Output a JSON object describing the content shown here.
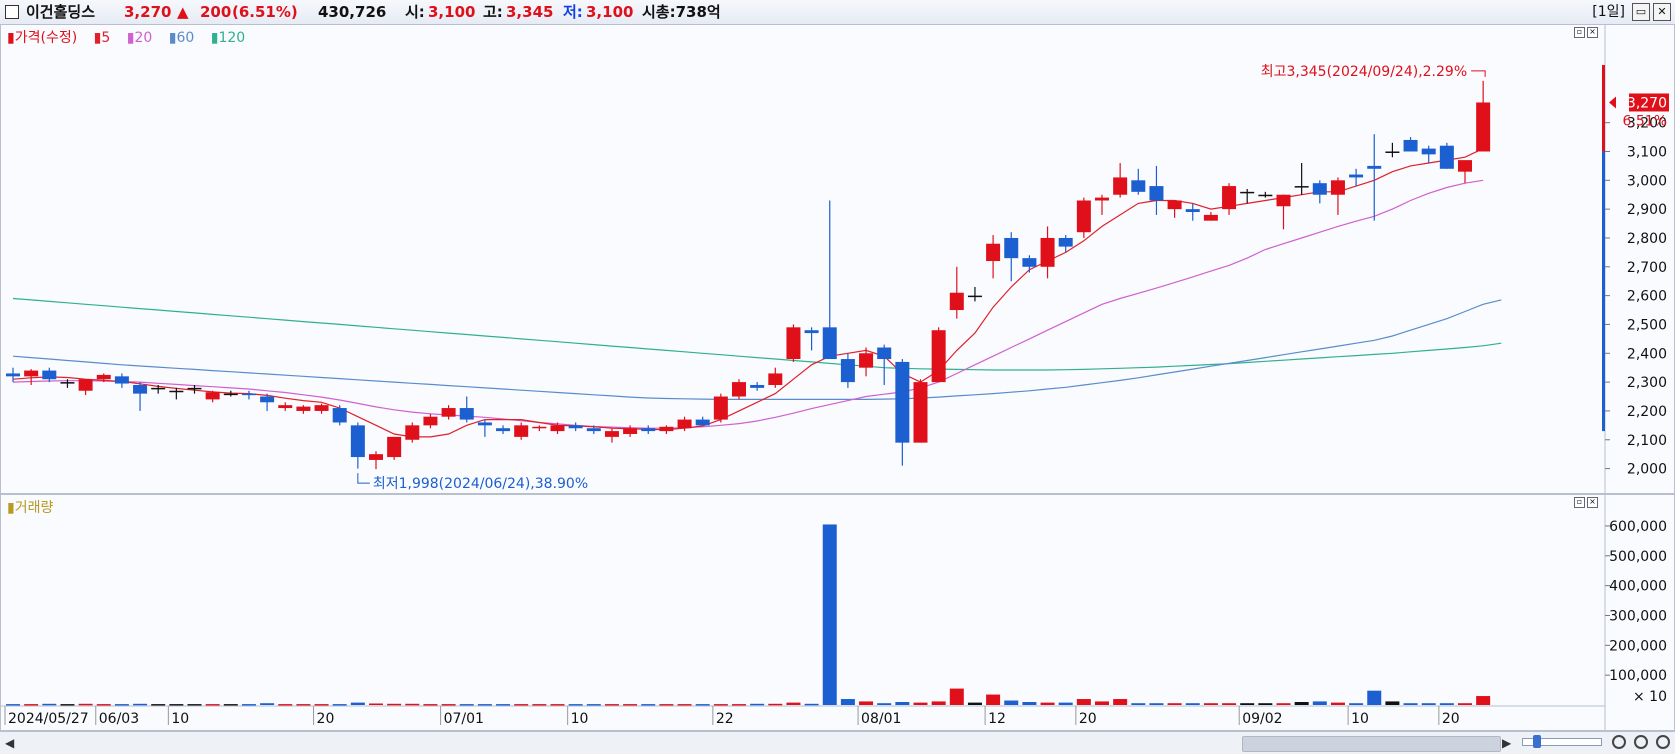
{
  "header": {
    "stock_name": "이건홀딩스",
    "price": "3,270",
    "change_arrow": "▲",
    "change": "200",
    "change_pct": "(6.51%)",
    "volume": "430,726",
    "open_label": "시:",
    "open": "3,100",
    "high_label": "고:",
    "high": "3,345",
    "low_label": "저:",
    "low": "3,100",
    "mktcap": "시총:738억",
    "period": "[1일]"
  },
  "price_panel": {
    "legend_title": "가격(수정)",
    "ma_labels": [
      "5",
      "20",
      "60",
      "120"
    ],
    "max_annotation": "최고3,345(2024/09/24),2.29%",
    "min_annotation": "최저1,998(2024/06/24),38.90%",
    "last_price_tag": "3,270",
    "last_pct_tag": "6.51%"
  },
  "volume_panel": {
    "legend_title": "거래량",
    "unit_label": "× 10"
  },
  "colors": {
    "up": "#e0101a",
    "down": "#1c5fd0",
    "ma5": "#e0202a",
    "ma20": "#d060d0",
    "ma60": "#5a8ccc",
    "ma120": "#30b090"
  },
  "chart_data": [
    {
      "type": "candlestick",
      "title": "가격(수정)",
      "y_axis_ticks": [
        2000,
        2100,
        2200,
        2300,
        2400,
        2500,
        2600,
        2700,
        2800,
        2900,
        3000,
        3100,
        3200
      ],
      "y_axis_labels": [
        "2,000",
        "2,100",
        "2,200",
        "2,300",
        "2,400",
        "2,500",
        "2,600",
        "2,700",
        "2,800",
        "2,900",
        "3,000",
        "3,100",
        "3,200"
      ],
      "ylim": [
        1950,
        3400
      ],
      "x_labels": [
        {
          "i": 0,
          "text": "2024/05/27"
        },
        {
          "i": 5,
          "text": "06/03"
        },
        {
          "i": 9,
          "text": "10"
        },
        {
          "i": 17,
          "text": "20"
        },
        {
          "i": 24,
          "text": "07/01"
        },
        {
          "i": 31,
          "text": "10"
        },
        {
          "i": 39,
          "text": "22"
        },
        {
          "i": 47,
          "text": "08/01"
        },
        {
          "i": 54,
          "text": "12"
        },
        {
          "i": 59,
          "text": "20"
        },
        {
          "i": 68,
          "text": "09/02"
        },
        {
          "i": 74,
          "text": "10"
        },
        {
          "i": 79,
          "text": "20"
        }
      ],
      "candles": [
        [
          2330,
          2350,
          2300,
          2320
        ],
        [
          2320,
          2345,
          2290,
          2340
        ],
        [
          2340,
          2350,
          2300,
          2310
        ],
        [
          2300,
          2310,
          2280,
          2300
        ],
        [
          2270,
          2310,
          2255,
          2310
        ],
        [
          2310,
          2330,
          2300,
          2325
        ],
        [
          2320,
          2330,
          2280,
          2295
        ],
        [
          2290,
          2300,
          2200,
          2260
        ],
        [
          2280,
          2290,
          2260,
          2280
        ],
        [
          2270,
          2280,
          2240,
          2270
        ],
        [
          2280,
          2290,
          2260,
          2280
        ],
        [
          2240,
          2270,
          2230,
          2265
        ],
        [
          2260,
          2270,
          2250,
          2260
        ],
        [
          2260,
          2270,
          2240,
          2255
        ],
        [
          2250,
          2260,
          2200,
          2230
        ],
        [
          2210,
          2230,
          2200,
          2220
        ],
        [
          2200,
          2220,
          2190,
          2215
        ],
        [
          2200,
          2225,
          2190,
          2220
        ],
        [
          2210,
          2220,
          2150,
          2160
        ],
        [
          2150,
          2160,
          2000,
          2040
        ],
        [
          2030,
          2060,
          1998,
          2050
        ],
        [
          2040,
          2110,
          2030,
          2110
        ],
        [
          2100,
          2160,
          2090,
          2150
        ],
        [
          2150,
          2190,
          2140,
          2180
        ],
        [
          2180,
          2220,
          2170,
          2210
        ],
        [
          2210,
          2250,
          2160,
          2170
        ],
        [
          2160,
          2170,
          2110,
          2150
        ],
        [
          2140,
          2150,
          2120,
          2130
        ],
        [
          2110,
          2160,
          2100,
          2150
        ],
        [
          2140,
          2150,
          2130,
          2145
        ],
        [
          2130,
          2160,
          2120,
          2150
        ],
        [
          2150,
          2160,
          2130,
          2140
        ],
        [
          2140,
          2150,
          2120,
          2130
        ],
        [
          2110,
          2140,
          2090,
          2130
        ],
        [
          2120,
          2150,
          2110,
          2140
        ],
        [
          2140,
          2150,
          2120,
          2130
        ],
        [
          2130,
          2150,
          2120,
          2145
        ],
        [
          2140,
          2180,
          2130,
          2170
        ],
        [
          2170,
          2180,
          2150,
          2150
        ],
        [
          2170,
          2260,
          2160,
          2250
        ],
        [
          2250,
          2310,
          2240,
          2300
        ],
        [
          2290,
          2300,
          2270,
          2280
        ],
        [
          2290,
          2350,
          2280,
          2330
        ],
        [
          2380,
          2500,
          2370,
          2490
        ],
        [
          2480,
          2490,
          2410,
          2470
        ],
        [
          2490,
          2930,
          2380,
          2380
        ],
        [
          2380,
          2400,
          2280,
          2300
        ],
        [
          2350,
          2420,
          2320,
          2400
        ],
        [
          2420,
          2430,
          2290,
          2380
        ],
        [
          2370,
          2380,
          2010,
          2090
        ],
        [
          2090,
          2310,
          2090,
          2300
        ],
        [
          2300,
          2490,
          2300,
          2480
        ],
        [
          2550,
          2700,
          2520,
          2610
        ],
        [
          2600,
          2630,
          2580,
          2600
        ],
        [
          2720,
          2810,
          2660,
          2780
        ],
        [
          2800,
          2820,
          2650,
          2730
        ],
        [
          2730,
          2740,
          2680,
          2700
        ],
        [
          2700,
          2840,
          2660,
          2800
        ],
        [
          2800,
          2810,
          2750,
          2770
        ],
        [
          2820,
          2940,
          2800,
          2930
        ],
        [
          2930,
          2950,
          2880,
          2940
        ],
        [
          2950,
          3060,
          2940,
          3010
        ],
        [
          3000,
          3040,
          2950,
          2960
        ],
        [
          2980,
          3050,
          2880,
          2930
        ],
        [
          2900,
          2920,
          2870,
          2930
        ],
        [
          2900,
          2920,
          2860,
          2890
        ],
        [
          2860,
          2890,
          2860,
          2880
        ],
        [
          2900,
          2990,
          2880,
          2980
        ],
        [
          2960,
          2970,
          2920,
          2960
        ],
        [
          2950,
          2960,
          2940,
          2950
        ],
        [
          2910,
          2950,
          2830,
          2950
        ],
        [
          2980,
          3060,
          2950,
          2980
        ],
        [
          2990,
          3000,
          2920,
          2950
        ],
        [
          2950,
          3010,
          2880,
          3000
        ],
        [
          3020,
          3040,
          2980,
          3010
        ],
        [
          3050,
          3160,
          2860,
          3040
        ],
        [
          3100,
          3130,
          3080,
          3100
        ],
        [
          3140,
          3150,
          3100,
          3100
        ],
        [
          3110,
          3120,
          3060,
          3090
        ],
        [
          3120,
          3130,
          3040,
          3040
        ],
        [
          3030,
          3060,
          2990,
          3070
        ],
        [
          3100,
          3345,
          3100,
          3270
        ]
      ],
      "ma5": [
        2310,
        2315,
        2318,
        2316,
        2310,
        2306,
        2302,
        2294,
        2285,
        2278,
        2272,
        2266,
        2262,
        2260,
        2254,
        2244,
        2236,
        2230,
        2210,
        2180,
        2150,
        2120,
        2110,
        2110,
        2120,
        2150,
        2170,
        2170,
        2170,
        2160,
        2150,
        2148,
        2145,
        2140,
        2138,
        2136,
        2135,
        2140,
        2148,
        2170,
        2200,
        2230,
        2260,
        2310,
        2360,
        2390,
        2400,
        2410,
        2390,
        2330,
        2300,
        2340,
        2410,
        2470,
        2560,
        2630,
        2690,
        2720,
        2750,
        2790,
        2840,
        2880,
        2920,
        2930,
        2930,
        2920,
        2900,
        2910,
        2920,
        2930,
        2940,
        2950,
        2960,
        2960,
        2980,
        3000,
        3030,
        3050,
        3060,
        3070,
        3080,
        3110
      ],
      "ma20": [
        2300,
        2302,
        2304,
        2305,
        2305,
        2304,
        2302,
        2300,
        2296,
        2292,
        2288,
        2284,
        2280,
        2276,
        2270,
        2264,
        2256,
        2248,
        2238,
        2226,
        2214,
        2204,
        2196,
        2190,
        2186,
        2182,
        2178,
        2172,
        2166,
        2160,
        2155,
        2150,
        2146,
        2144,
        2142,
        2140,
        2140,
        2142,
        2145,
        2150,
        2156,
        2165,
        2178,
        2192,
        2208,
        2222,
        2236,
        2250,
        2258,
        2266,
        2280,
        2300,
        2330,
        2360,
        2390,
        2420,
        2450,
        2480,
        2510,
        2540,
        2570,
        2590,
        2608,
        2626,
        2645,
        2665,
        2685,
        2705,
        2730,
        2760,
        2780,
        2800,
        2820,
        2840,
        2858,
        2875,
        2900,
        2930,
        2955,
        2975,
        2990,
        3000
      ],
      "ma60": [
        2390,
        2385,
        2380,
        2375,
        2370,
        2365,
        2360,
        2356,
        2352,
        2348,
        2344,
        2340,
        2336,
        2332,
        2328,
        2324,
        2320,
        2316,
        2312,
        2308,
        2304,
        2300,
        2296,
        2292,
        2288,
        2284,
        2280,
        2276,
        2272,
        2268,
        2264,
        2260,
        2256,
        2252,
        2248,
        2245,
        2243,
        2242,
        2241,
        2240,
        2240,
        2240,
        2240,
        2240,
        2240,
        2240,
        2240,
        2240,
        2241,
        2242,
        2245,
        2248,
        2252,
        2256,
        2260,
        2265,
        2270,
        2276,
        2282,
        2290,
        2298,
        2306,
        2315,
        2325,
        2335,
        2345,
        2355,
        2365,
        2375,
        2385,
        2395,
        2405,
        2415,
        2425,
        2435,
        2445,
        2460,
        2480,
        2500,
        2520,
        2545,
        2570,
        2585
      ],
      "ma120": [
        2590,
        2585,
        2580,
        2575,
        2570,
        2565,
        2560,
        2555,
        2550,
        2545,
        2540,
        2535,
        2530,
        2525,
        2520,
        2515,
        2510,
        2505,
        2500,
        2495,
        2490,
        2485,
        2480,
        2475,
        2470,
        2465,
        2460,
        2455,
        2450,
        2445,
        2440,
        2435,
        2430,
        2425,
        2420,
        2415,
        2410,
        2405,
        2400,
        2395,
        2390,
        2385,
        2380,
        2375,
        2370,
        2365,
        2360,
        2355,
        2350,
        2348,
        2346,
        2345,
        2344,
        2343,
        2342,
        2342,
        2342,
        2342,
        2343,
        2344,
        2346,
        2348,
        2350,
        2352,
        2355,
        2358,
        2361,
        2364,
        2368,
        2372,
        2376,
        2380,
        2384,
        2388,
        2392,
        2396,
        2400,
        2405,
        2410,
        2415,
        2420,
        2426,
        2435
      ]
    },
    {
      "type": "bar",
      "title": "거래량",
      "y_axis_ticks": [
        100000,
        200000,
        300000,
        400000,
        500000,
        600000
      ],
      "y_axis_labels": [
        "100,000",
        "200,000",
        "300,000",
        "400,000",
        "500,000",
        "600,000"
      ],
      "ylim": [
        0,
        630000
      ],
      "values": [
        3000,
        3000,
        4000,
        3000,
        4000,
        3000,
        3000,
        4000,
        3000,
        3000,
        3000,
        3000,
        3000,
        3000,
        6000,
        3000,
        3000,
        3000,
        3000,
        8000,
        5000,
        4000,
        4000,
        3000,
        3000,
        3000,
        3000,
        3000,
        3000,
        3000,
        3000,
        3000,
        3000,
        3000,
        3000,
        3000,
        3000,
        3000,
        3000,
        3000,
        3000,
        4000,
        4000,
        8000,
        4000,
        605000,
        20000,
        12000,
        6000,
        10000,
        8000,
        12000,
        55000,
        8000,
        35000,
        15000,
        10000,
        8000,
        8000,
        20000,
        12000,
        20000,
        6000,
        6000,
        6000,
        6000,
        6000,
        6000,
        6000,
        6000,
        6000,
        10000,
        12000,
        8000,
        6000,
        48000,
        12000,
        6000,
        6000,
        6000,
        6000,
        30000
      ]
    }
  ]
}
